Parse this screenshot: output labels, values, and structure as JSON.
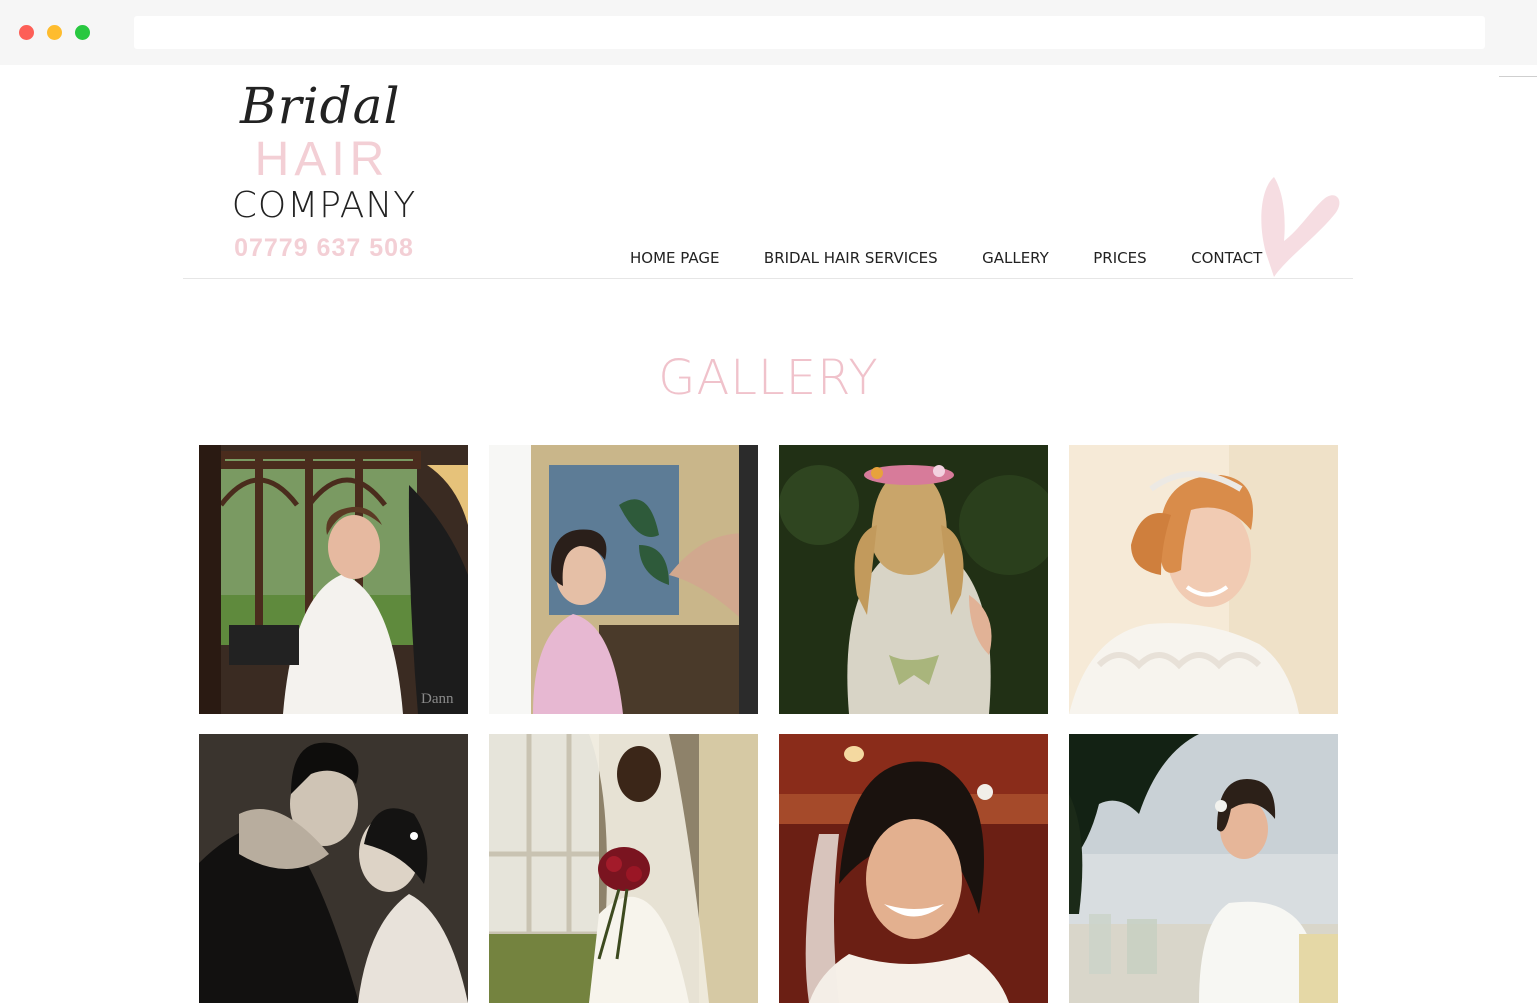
{
  "logo": {
    "line1": "Bridal",
    "line2": "HAIR",
    "line3": "COMPANY",
    "phone": "07779 637 508"
  },
  "nav": {
    "items": [
      "HOME PAGE",
      "BRIDAL HAIR SERVICES",
      "GALLERY",
      "PRICES",
      "CONTACT"
    ]
  },
  "page": {
    "title": "GALLERY"
  },
  "gallery": {
    "photos": [
      {
        "subject": "bride-having-hair-styled-by-window"
      },
      {
        "subject": "bride-having-makeup-applied"
      },
      {
        "subject": "bride-back-view-flower-crown-lace-dress"
      },
      {
        "subject": "smiling-bride-with-tiara-and-updo"
      },
      {
        "subject": "couple-kissing-black-and-white"
      },
      {
        "subject": "bride-with-veil-holding-red-bouquet"
      },
      {
        "subject": "smiling-bride-with-veil-and-curls"
      },
      {
        "subject": "bride-seated-at-sunset-table"
      }
    ],
    "watermark": "Dann"
  },
  "colors": {
    "accent_pink": "#f3cfd5",
    "title_pink": "#f0c2cb",
    "text_dark": "#222222"
  }
}
